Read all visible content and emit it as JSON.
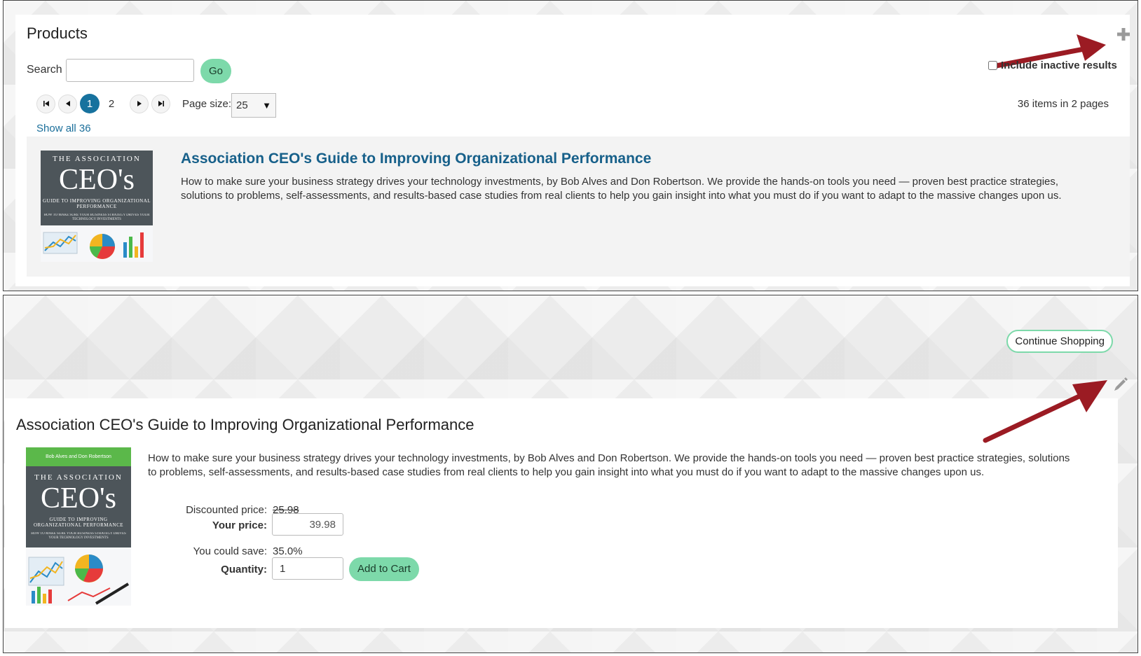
{
  "colors": {
    "accent_green": "#7dd9aa",
    "link_blue": "#17608a",
    "active_page": "#17729e",
    "annotation_arrow": "#9b1b23",
    "book_cover": "#4d555a"
  },
  "products_panel": {
    "title": "Products",
    "add_icon": "plus-icon",
    "search": {
      "label": "Search",
      "value": "",
      "button_label": "Go"
    },
    "include_inactive": {
      "label": "Include inactive results",
      "checked": false
    },
    "pager": {
      "first_icon": "first-page-icon",
      "prev_icon": "prev-page-icon",
      "pages": [
        "1",
        "2"
      ],
      "current_page": "1",
      "next_icon": "next-page-icon",
      "last_icon": "last-page-icon"
    },
    "page_size": {
      "label": "Page size:",
      "value": "25"
    },
    "items_count": "36 items in 2 pages",
    "show_all": "Show all 36",
    "product": {
      "title": "Association CEO's Guide to Improving Organizational Performance",
      "description": "How to make sure your business strategy drives your technology investments, by Bob Alves and Don Robertson. We provide the hands-on tools you need — proven best practice strategies, solutions to problems, self-assessments, and results-based case studies from real clients to help you gain insight into what you must do if you want to adapt to the massive changes upon us.",
      "cover": {
        "line1": "THE ASSOCIATION",
        "line2": "CEO's",
        "line3": "GUIDE TO IMPROVING ORGANIZATIONAL PERFORMANCE",
        "line4": "HOW TO MAKE SURE YOUR BUSINESS STRATEGY DRIVES YOUR TECHNOLOGY INVESTMENTS"
      }
    }
  },
  "detail_panel": {
    "continue_label": "Continue Shopping",
    "edit_icon": "pencil-icon",
    "title": "Association CEO's Guide to Improving Organizational Performance",
    "description": "How to make sure your business strategy drives your technology investments, by Bob Alves and Don Robertson. We provide the hands-on tools you need — proven best practice strategies, solutions to problems, self-assessments, and results-based case studies from real clients to help you gain insight into what you must do if you want to adapt to the massive changes upon us.",
    "cover": {
      "authors": "Bob Alves and Don Robertson",
      "line1": "THE ASSOCIATION",
      "line2": "CEO's",
      "line3": "GUIDE TO IMPROVING ORGANIZATIONAL PERFORMANCE",
      "line4": "HOW TO MAKE SURE YOUR BUSINESS STRATEGY DRIVES YOUR TECHNOLOGY INVESTMENTS"
    },
    "discounted_label": "Discounted price:",
    "discounted_value": "25.98",
    "your_price_label": "Your price:",
    "your_price_value": "39.98",
    "save_label": "You could save:",
    "save_value": "35.0%",
    "quantity_label": "Quantity:",
    "quantity_value": "1",
    "add_to_cart_label": "Add to Cart"
  }
}
